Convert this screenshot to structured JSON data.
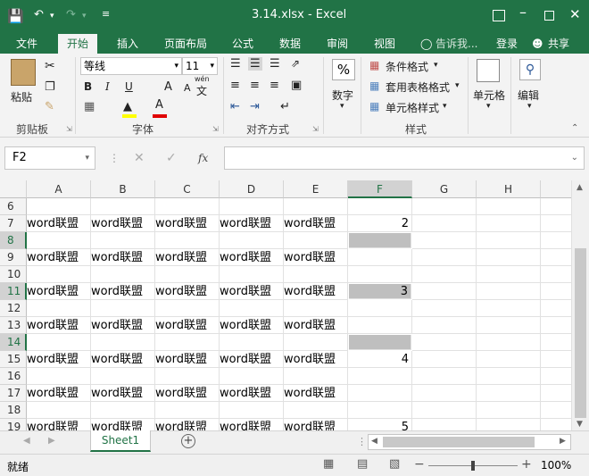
{
  "titlebar": {
    "title": "3.14.xlsx - Excel"
  },
  "tabs": [
    "文件",
    "开始",
    "插入",
    "页面布局",
    "公式",
    "数据",
    "审阅",
    "视图"
  ],
  "tell_me": "告诉我...",
  "login": "登录",
  "share": "共享",
  "ribbon": {
    "paste": "粘贴",
    "clipboard_group": "剪贴板",
    "font_name": "等线",
    "font_size": "11",
    "font_group": "字体",
    "bold": "B",
    "italic": "I",
    "underline": "U",
    "grow_font": "A",
    "shrink_font": "A",
    "wen": "wén",
    "wen_char": "文",
    "align_group": "对齐方式",
    "number_pct": "%",
    "number_label": "数字",
    "cond_format": "条件格式",
    "table_format": "套用表格格式",
    "cell_style": "单元格样式",
    "style_group": "样式",
    "cells": "单元格",
    "edit": "编辑"
  },
  "formula_bar": {
    "name_box": "F2",
    "fx": "fx",
    "content": ""
  },
  "columns": [
    "A",
    "B",
    "C",
    "D",
    "E",
    "F",
    "G",
    "H"
  ],
  "selected_column": "F",
  "rows": [
    {
      "num": "6",
      "cells": [
        "",
        "",
        "",
        "",
        "",
        ""
      ],
      "gray": false,
      "sel": false
    },
    {
      "num": "7",
      "cells": [
        "word联盟",
        "word联盟",
        "word联盟",
        "word联盟",
        "word联盟",
        "2"
      ],
      "gray": false,
      "sel": false
    },
    {
      "num": "8",
      "cells": [
        "",
        "",
        "",
        "",
        "",
        ""
      ],
      "gray": true,
      "sel": true
    },
    {
      "num": "9",
      "cells": [
        "word联盟",
        "word联盟",
        "word联盟",
        "word联盟",
        "word联盟",
        ""
      ],
      "gray": false,
      "sel": false
    },
    {
      "num": "10",
      "cells": [
        "",
        "",
        "",
        "",
        "",
        ""
      ],
      "gray": false,
      "sel": false
    },
    {
      "num": "11",
      "cells": [
        "word联盟",
        "word联盟",
        "word联盟",
        "word联盟",
        "word联盟",
        "3"
      ],
      "gray": true,
      "sel": true
    },
    {
      "num": "12",
      "cells": [
        "",
        "",
        "",
        "",
        "",
        ""
      ],
      "gray": false,
      "sel": false
    },
    {
      "num": "13",
      "cells": [
        "word联盟",
        "word联盟",
        "word联盟",
        "word联盟",
        "word联盟",
        ""
      ],
      "gray": false,
      "sel": false
    },
    {
      "num": "14",
      "cells": [
        "",
        "",
        "",
        "",
        "",
        ""
      ],
      "gray": true,
      "sel": true
    },
    {
      "num": "15",
      "cells": [
        "word联盟",
        "word联盟",
        "word联盟",
        "word联盟",
        "word联盟",
        "4"
      ],
      "gray": false,
      "sel": false
    },
    {
      "num": "16",
      "cells": [
        "",
        "",
        "",
        "",
        "",
        ""
      ],
      "gray": false,
      "sel": false
    },
    {
      "num": "17",
      "cells": [
        "word联盟",
        "word联盟",
        "word联盟",
        "word联盟",
        "word联盟",
        ""
      ],
      "gray": false,
      "sel": false
    },
    {
      "num": "18",
      "cells": [
        "",
        "",
        "",
        "",
        "",
        ""
      ],
      "gray": false,
      "sel": false
    },
    {
      "num": "19",
      "cells": [
        "word联盟",
        "word联盟",
        "word联盟",
        "word联盟",
        "word联盟",
        "5"
      ],
      "gray": false,
      "sel": false
    }
  ],
  "sheet_tab": "Sheet1",
  "add_sheet": "+",
  "status": {
    "ready": "就绪",
    "zoom": "100%",
    "minus": "−",
    "plus": "+"
  },
  "colors": {
    "accent": "#217346",
    "selection_gray": "#bfbfbf"
  }
}
